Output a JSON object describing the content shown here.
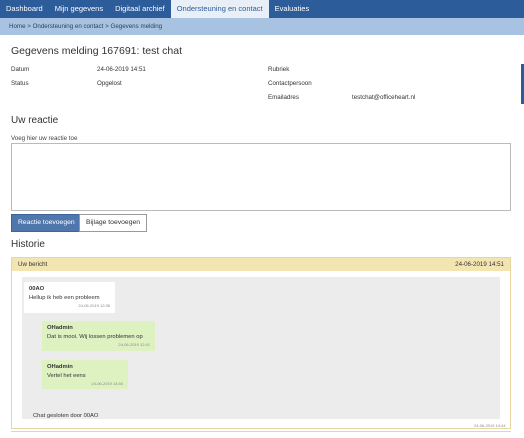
{
  "nav": {
    "tabs": [
      {
        "label": "Dashboard"
      },
      {
        "label": "Mijn gegevens"
      },
      {
        "label": "Digitaal archief"
      },
      {
        "label": "Ondersteuning en contact",
        "active": true
      },
      {
        "label": "Evaluaties"
      }
    ]
  },
  "breadcrumb": {
    "home": "Home",
    "sep1": " > ",
    "level1": "Ondersteuning en contact",
    "sep2": " > ",
    "current": "Gegevens melding"
  },
  "page": {
    "title": "Gegevens melding 167691: test chat"
  },
  "details": {
    "datum_label": "Datum",
    "datum_value": "24-06-2019 14:51",
    "status_label": "Status",
    "status_value": "Opgelost",
    "rubriek_label": "Rubriek",
    "rubriek_value": "",
    "contact_label": "Contactpersoon",
    "contact_value": "",
    "email_label": "Emailadres",
    "email_value": "testchat@officeheart.nl"
  },
  "reply": {
    "heading": "Uw reactie",
    "field_label": "Voeg hier uw reactie toe",
    "field_value": "",
    "submit_label": "Reactie toevoegen",
    "attach_label": "Bijlage toevoegen"
  },
  "history": {
    "heading": "Historie",
    "panel_label": "Uw bericht",
    "panel_date": "24-06-2019 14:51",
    "messages": [
      {
        "author": "00AO",
        "text": "Hellup ik heb een probleem",
        "time": "24-06-2019 12:36",
        "direction": "in"
      },
      {
        "author": "OHadmin",
        "text": "Dat is mooi. Wij lossen problemen op",
        "time": "24-06-2019 12:41",
        "direction": "out"
      },
      {
        "author": "OHadmin",
        "text": "Vertel het eens",
        "time": "24-06-2019 14:50",
        "direction": "out"
      }
    ],
    "closed_text": "Chat gesloten door 00AO",
    "closed_time": "24-06-2019 14:44"
  },
  "colors": {
    "nav_bg": "#2d5c9a",
    "breadcrumb_bg": "#a8c3e1",
    "panel_header_bg": "#f3e5b2",
    "bubble_out_bg": "#ddf2c0",
    "primary_button": "#4f77ad"
  }
}
